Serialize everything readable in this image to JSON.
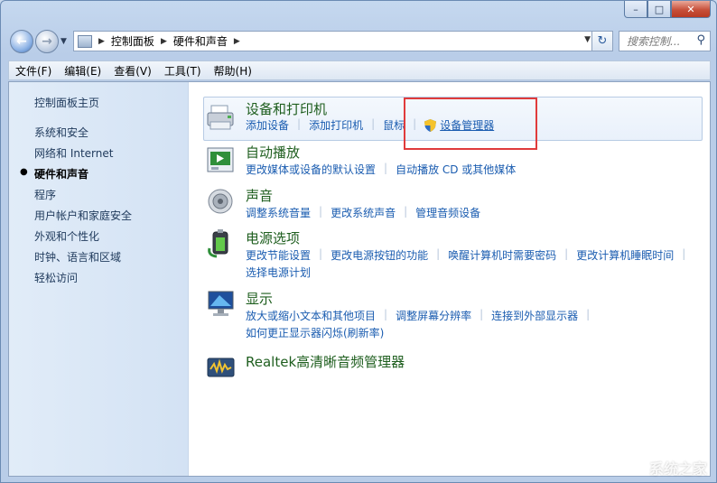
{
  "window": {
    "minimize_label": "–",
    "maximize_label": "□",
    "close_label": "✕"
  },
  "navbar": {
    "breadcrumb": [
      "控制面板",
      "硬件和声音"
    ],
    "search_placeholder": "搜索控制...",
    "back_glyph": "←",
    "forward_glyph": "→",
    "refresh_glyph": "↻"
  },
  "menu": [
    "文件(F)",
    "编辑(E)",
    "查看(V)",
    "工具(T)",
    "帮助(H)"
  ],
  "sidebar": {
    "items": [
      {
        "label": "控制面板主页"
      },
      {
        "label": "系统和安全"
      },
      {
        "label": "网络和 Internet"
      },
      {
        "label": "硬件和声音",
        "active": true
      },
      {
        "label": "程序"
      },
      {
        "label": "用户帐户和家庭安全"
      },
      {
        "label": "外观和个性化"
      },
      {
        "label": "时钟、语言和区域"
      },
      {
        "label": "轻松访问"
      }
    ]
  },
  "categories": [
    {
      "title": "设备和打印机",
      "icon": "printer-icon",
      "links": [
        "添加设备",
        "添加打印机",
        "鼠标"
      ],
      "shield_link": "设备管理器"
    },
    {
      "title": "自动播放",
      "icon": "autoplay-icon",
      "links": [
        "更改媒体或设备的默认设置",
        "自动播放 CD 或其他媒体"
      ]
    },
    {
      "title": "声音",
      "icon": "speaker-icon",
      "links": [
        "调整系统音量",
        "更改系统声音",
        "管理音频设备"
      ]
    },
    {
      "title": "电源选项",
      "icon": "battery-icon",
      "links": [
        "更改节能设置",
        "更改电源按钮的功能",
        "唤醒计算机时需要密码",
        "更改计算机睡眠时间"
      ],
      "links2": [
        "选择电源计划"
      ]
    },
    {
      "title": "显示",
      "icon": "monitor-icon",
      "links": [
        "放大或缩小文本和其他项目",
        "调整屏幕分辨率",
        "连接到外部显示器"
      ],
      "links2": [
        "如何更正显示器闪烁(刷新率)"
      ]
    },
    {
      "title": "Realtek高清晰音频管理器",
      "icon": "realtek-icon",
      "links": []
    }
  ],
  "watermark": "系统之家",
  "colors": {
    "link": "#1a5cb0",
    "category_title": "#1e5e1e",
    "annotation_box": "#e03b3b"
  }
}
